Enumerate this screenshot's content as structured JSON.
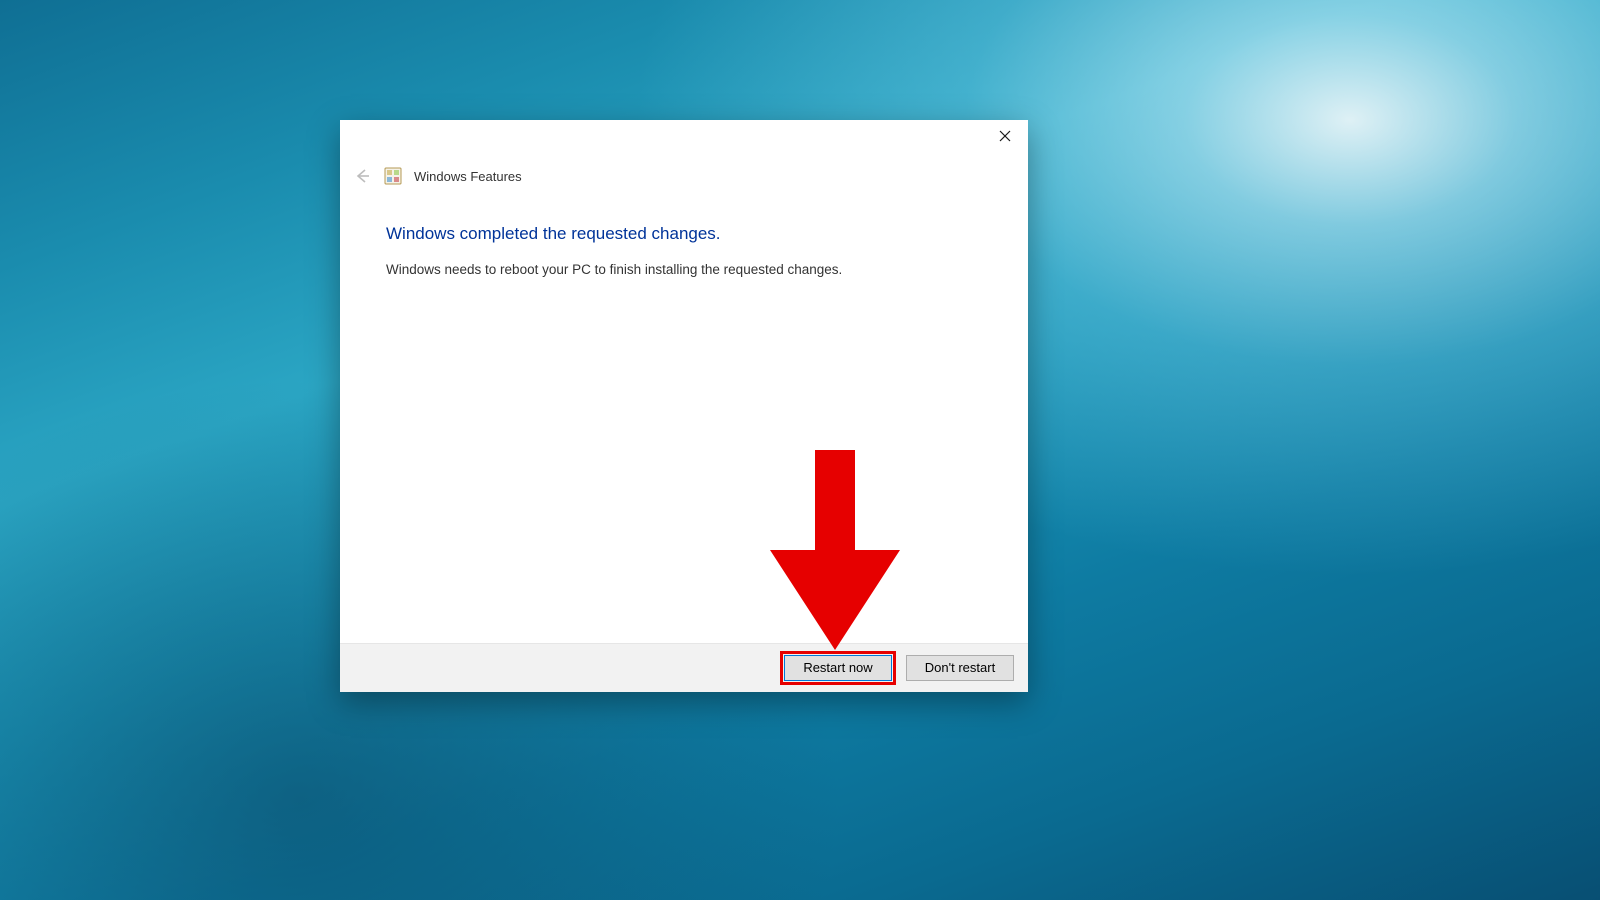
{
  "dialog": {
    "app_title": "Windows Features",
    "heading": "Windows completed the requested changes.",
    "message": "Windows needs to reboot your PC to finish installing the requested changes.",
    "buttons": {
      "restart_now": "Restart now",
      "dont_restart": "Don't restart"
    }
  }
}
